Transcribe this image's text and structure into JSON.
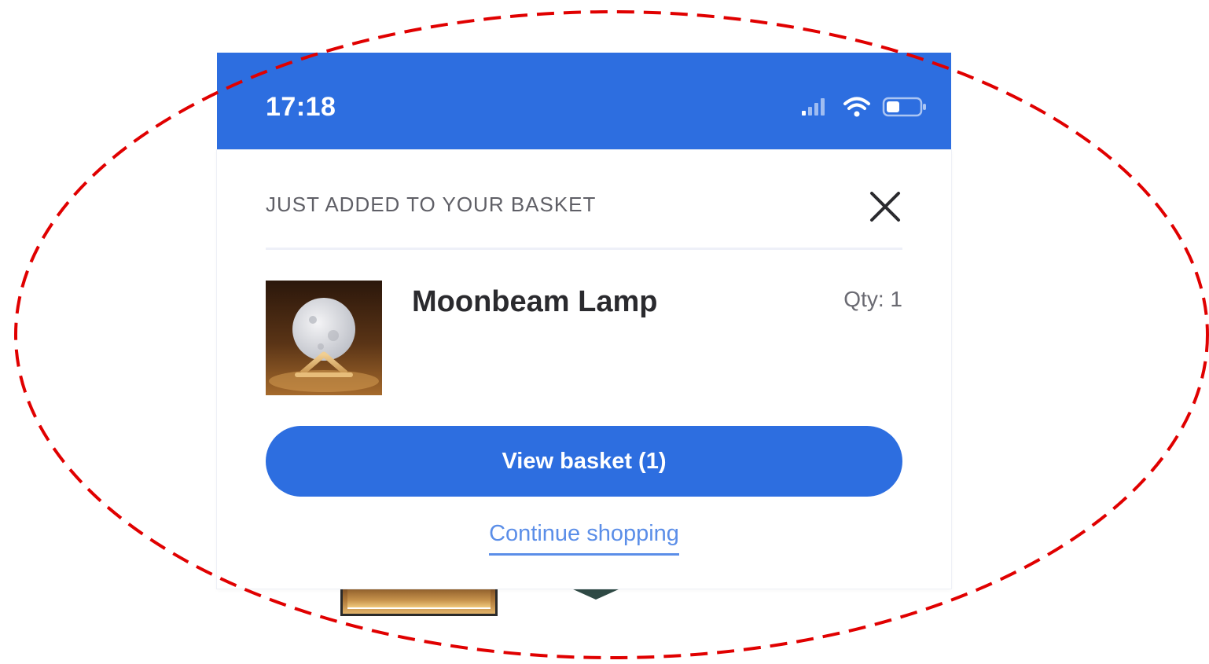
{
  "status_bar": {
    "time": "17:18",
    "icons": [
      "signal-icon",
      "wifi-icon",
      "battery-icon"
    ],
    "background_color": "#2d6ee0"
  },
  "popup": {
    "title": "JUST ADDED TO YOUR BASKET",
    "close_icon": "close-icon",
    "product": {
      "name": "Moonbeam Lamp",
      "qty_label": "Qty: 1"
    },
    "view_basket_label": "View basket (1)",
    "continue_label": "Continue shopping",
    "accent_color": "#2d6ee0"
  },
  "annotation": {
    "color": "#e00000",
    "style": "dashed ellipse"
  }
}
